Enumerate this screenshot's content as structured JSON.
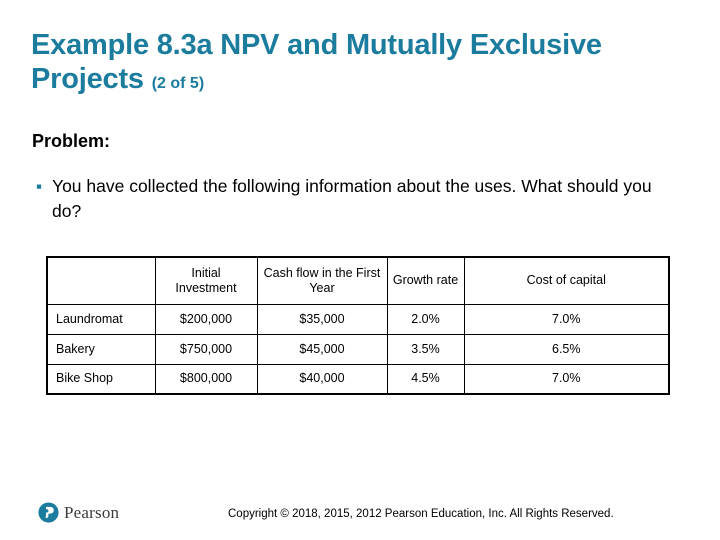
{
  "slide": {
    "title_main": "Example 8.3a NPV and Mutually Exclusive Projects",
    "title_counter": "(2 of 5)",
    "problem_label": "Problem:",
    "bullet_text": "You have collected the following information about the uses. What should you do?",
    "bullet_glyph": "▪",
    "accent_color": "#1b7c9e"
  },
  "table": {
    "columns": [
      "",
      "Initial Investment",
      "Cash flow in the First Year",
      "Growth rate",
      "Cost of capital"
    ],
    "rows": [
      {
        "name": "Laundromat",
        "initial_investment": "$200,000",
        "cash_flow_first_year": "$35,000",
        "growth_rate": "2.0%",
        "cost_of_capital": "7.0%"
      },
      {
        "name": "Bakery",
        "initial_investment": "$750,000",
        "cash_flow_first_year": "$45,000",
        "growth_rate": "3.5%",
        "cost_of_capital": "6.5%"
      },
      {
        "name": "Bike Shop",
        "initial_investment": "$800,000",
        "cash_flow_first_year": "$40,000",
        "growth_rate": "4.5%",
        "cost_of_capital": "7.0%"
      }
    ]
  },
  "footer": {
    "logo_text": "Pearson",
    "logo_color": "#1b7c9e",
    "copyright": "Copyright © 2018, 2015, 2012 Pearson Education, Inc. All Rights Reserved."
  }
}
